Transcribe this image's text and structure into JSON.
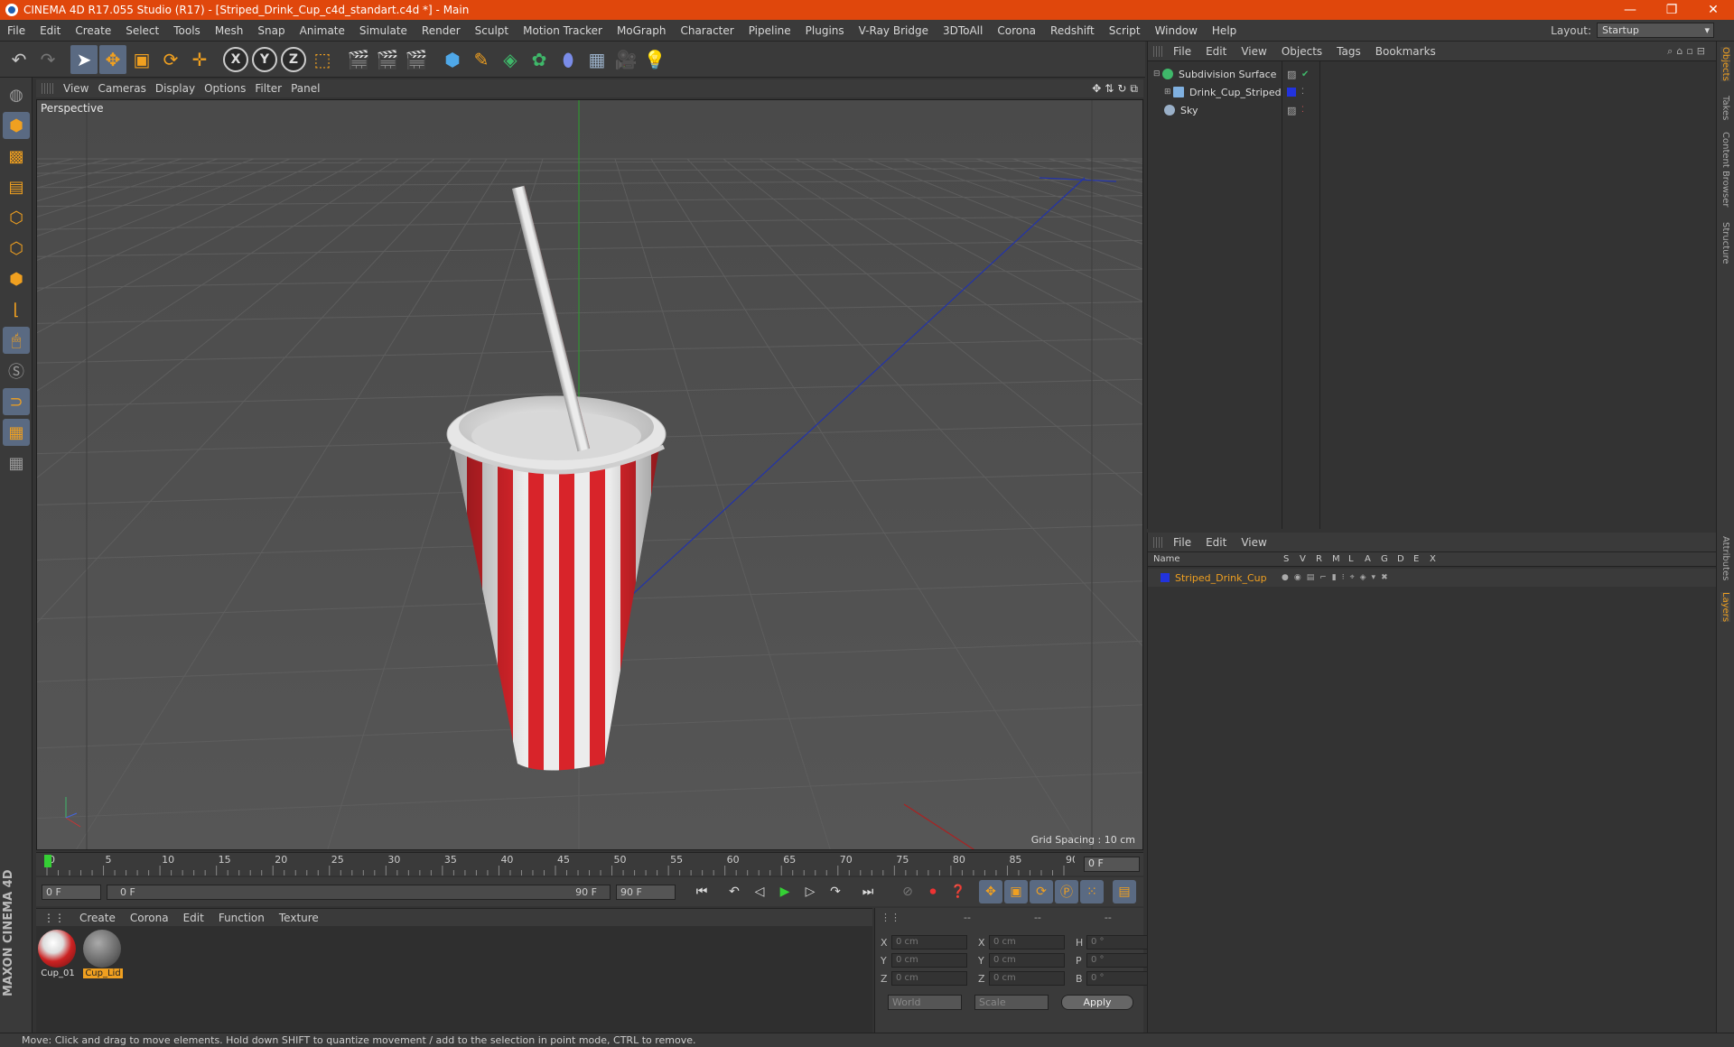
{
  "window": {
    "title": "CINEMA 4D R17.055 Studio (R17) - [Striped_Drink_Cup_c4d_standart.c4d *] - Main",
    "minimize": "—",
    "maximize": "❐",
    "close": "✕"
  },
  "menu": [
    "File",
    "Edit",
    "Create",
    "Select",
    "Tools",
    "Mesh",
    "Snap",
    "Animate",
    "Simulate",
    "Render",
    "Sculpt",
    "Motion Tracker",
    "MoGraph",
    "Character",
    "Pipeline",
    "Plugins",
    "V-Ray Bridge",
    "3DToAll",
    "Corona",
    "Redshift",
    "Script",
    "Window",
    "Help"
  ],
  "layout": {
    "label": "Layout:",
    "value": "Startup"
  },
  "toolbar": {
    "undo": "undo-icon",
    "redo": "redo-icon",
    "axes": [
      "X",
      "Y",
      "Z"
    ]
  },
  "viewport": {
    "menu": [
      "View",
      "Cameras",
      "Display",
      "Options",
      "Filter",
      "Panel"
    ],
    "camera_label": "Perspective",
    "grid_spacing": "Grid Spacing : 10 cm"
  },
  "timeline": {
    "ticks": [
      "0",
      "5",
      "10",
      "15",
      "20",
      "25",
      "30",
      "35",
      "40",
      "45",
      "50",
      "55",
      "60",
      "65",
      "70",
      "75",
      "80",
      "85",
      "90"
    ],
    "current_frame": "0 F",
    "start": "0 F",
    "range_start": "0 F",
    "range_end": "90 F",
    "end": "90 F"
  },
  "materials": {
    "menu": [
      "Create",
      "Corona",
      "Edit",
      "Function",
      "Texture"
    ],
    "items": [
      {
        "name": "Cup_01",
        "selected": false
      },
      {
        "name": "Cup_Lid",
        "selected": true
      }
    ]
  },
  "coordinates": {
    "header": [
      "--",
      "--",
      "--"
    ],
    "rows": [
      {
        "a1": "X",
        "v1": "0 cm",
        "a2": "X",
        "v2": "0 cm",
        "a3": "H",
        "v3": "0 °"
      },
      {
        "a1": "Y",
        "v1": "0 cm",
        "a2": "Y",
        "v2": "0 cm",
        "a3": "P",
        "v3": "0 °"
      },
      {
        "a1": "Z",
        "v1": "0 cm",
        "a2": "Z",
        "v2": "0 cm",
        "a3": "B",
        "v3": "0 °"
      }
    ],
    "mode": "World",
    "type": "Scale",
    "apply": "Apply"
  },
  "objects": {
    "menu": [
      "File",
      "Edit",
      "View",
      "Objects",
      "Tags",
      "Bookmarks"
    ],
    "items": [
      {
        "name": "Subdivision Surface",
        "icon_color": "#3fb86a"
      },
      {
        "name": "Drink_Cup_Striped",
        "icon_color": "#7fb0e0"
      },
      {
        "name": "Sky",
        "icon_color": "#9ab0c8"
      }
    ]
  },
  "layers": {
    "menu": [
      "File",
      "Edit",
      "View"
    ],
    "columns": [
      "Name",
      "S",
      "V",
      "R",
      "M",
      "L",
      "A",
      "G",
      "D",
      "E",
      "X"
    ],
    "items": [
      {
        "name": "Striped_Drink_Cup",
        "color": "#2233dd"
      }
    ]
  },
  "side_tabs": [
    "Objects",
    "Takes",
    "Content Browser",
    "Structure",
    "Attributes",
    "Layers"
  ],
  "status": "Move: Click and drag to move elements. Hold down SHIFT to quantize movement / add to the selection in point mode, CTRL to remove.",
  "branding": "MAXON CINEMA 4D",
  "colors": {
    "accent": "#e0470c",
    "highlight": "#f0a020",
    "stripe_red": "#d8242a"
  }
}
